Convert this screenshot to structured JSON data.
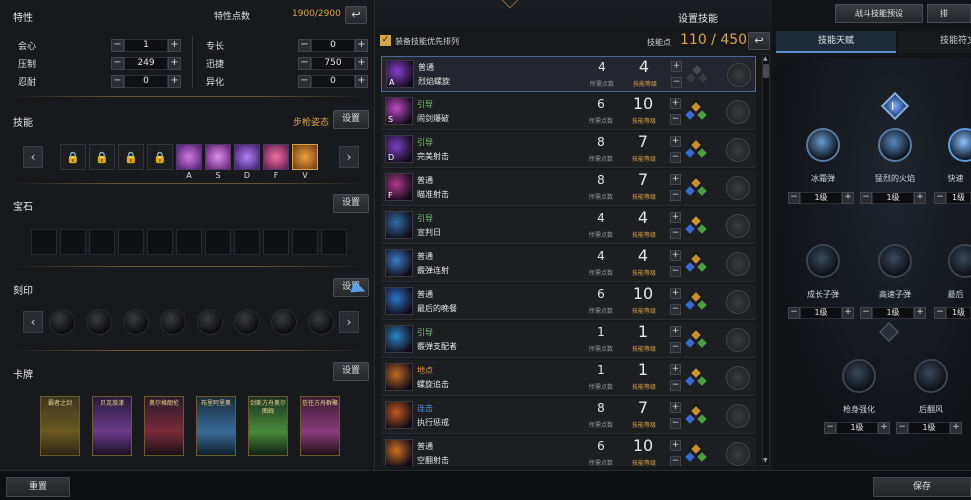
{
  "traits": {
    "title": "特性",
    "points_label": "特性点数",
    "points_value": "1900/2900",
    "left": [
      {
        "label": "会心",
        "value": "1"
      },
      {
        "label": "压制",
        "value": "249"
      },
      {
        "label": "忍耐",
        "value": "0"
      }
    ],
    "right": [
      {
        "label": "专长",
        "value": "0"
      },
      {
        "label": "迅捷",
        "value": "750"
      },
      {
        "label": "异化",
        "value": "0"
      }
    ]
  },
  "skills_section": {
    "title": "技能",
    "stance": "步枪姿态",
    "setting": "设置",
    "keys": [
      "A",
      "S",
      "D",
      "F",
      "V"
    ]
  },
  "gems": {
    "title": "宝石",
    "setting": "设置"
  },
  "engraving": {
    "title": "刻印",
    "setting": "设置"
  },
  "cards": {
    "title": "卡牌",
    "setting": "设置",
    "items": [
      "霸者之剑",
      "贝克旅津",
      "奥尔格朗伦",
      "布里阿里奥",
      "剑斯方舟奥尔图姆",
      "信任方舟群聚"
    ]
  },
  "middle": {
    "title": "设置技能",
    "priority_label": "装备技能优先排列",
    "skill_points_label": "技能点",
    "skill_points_value": "110 / 450",
    "cost_label": "所需点数",
    "level_label": "技能等级",
    "skills": [
      {
        "type": "普通",
        "name": "烈焰螺旋",
        "key": "A",
        "cost": "4",
        "level": "4",
        "type_color": "#e8e8e8",
        "icon_color": "#8a3fd0"
      },
      {
        "type": "引导",
        "name": "闹剑爆破",
        "key": "S",
        "cost": "6",
        "level": "10",
        "type_color": "#6fd06a",
        "icon_color": "#c24ac8"
      },
      {
        "type": "引导",
        "name": "完美射击",
        "key": "D",
        "cost": "8",
        "level": "7",
        "type_color": "#6fd06a",
        "icon_color": "#7b3fc4"
      },
      {
        "type": "普通",
        "name": "瞄准射击",
        "key": "F",
        "cost": "8",
        "level": "7",
        "type_color": "#e8e8e8",
        "icon_color": "#b03a8a"
      },
      {
        "type": "引导",
        "name": "宣判日",
        "key": "",
        "cost": "4",
        "level": "4",
        "type_color": "#6fd06a",
        "icon_color": "#2f6ea8"
      },
      {
        "type": "普通",
        "name": "霰弹连射",
        "key": "",
        "cost": "4",
        "level": "4",
        "type_color": "#e8e8e8",
        "icon_color": "#3a7cc8"
      },
      {
        "type": "普通",
        "name": "最后的晚餐",
        "key": "",
        "cost": "6",
        "level": "10",
        "type_color": "#e8e8e8",
        "icon_color": "#2a74c8"
      },
      {
        "type": "引导",
        "name": "霰弹支配者",
        "key": "",
        "cost": "1",
        "level": "1",
        "type_color": "#6fd06a",
        "icon_color": "#2a86c4"
      },
      {
        "type": "地点",
        "name": "螺旋追击",
        "key": "",
        "cost": "1",
        "level": "1",
        "type_color": "#e89040",
        "icon_color": "#c06a20"
      },
      {
        "type": "连击",
        "name": "执行惩戒",
        "key": "",
        "cost": "8",
        "level": "7",
        "type_color": "#4a9ae0",
        "icon_color": "#c05a20"
      },
      {
        "type": "普通",
        "name": "空翻射击",
        "key": "",
        "cost": "6",
        "level": "10",
        "type_color": "#e8e8e8",
        "icon_color": "#d07020"
      }
    ]
  },
  "right": {
    "preset_label": "战斗技能预设",
    "other_tab": "排",
    "tabs": [
      "技能天赋",
      "技能符文"
    ],
    "nodes_row1": [
      "冰霜弹",
      "猛烈的火焰",
      "快速"
    ],
    "nodes_row2": [
      "成长子弹",
      "高速子弹",
      "最后"
    ],
    "nodes_row3": [
      "枪身强化",
      "后翻风"
    ],
    "level_value": "1级"
  },
  "bottom": {
    "reset": "重置",
    "save": "保存"
  }
}
